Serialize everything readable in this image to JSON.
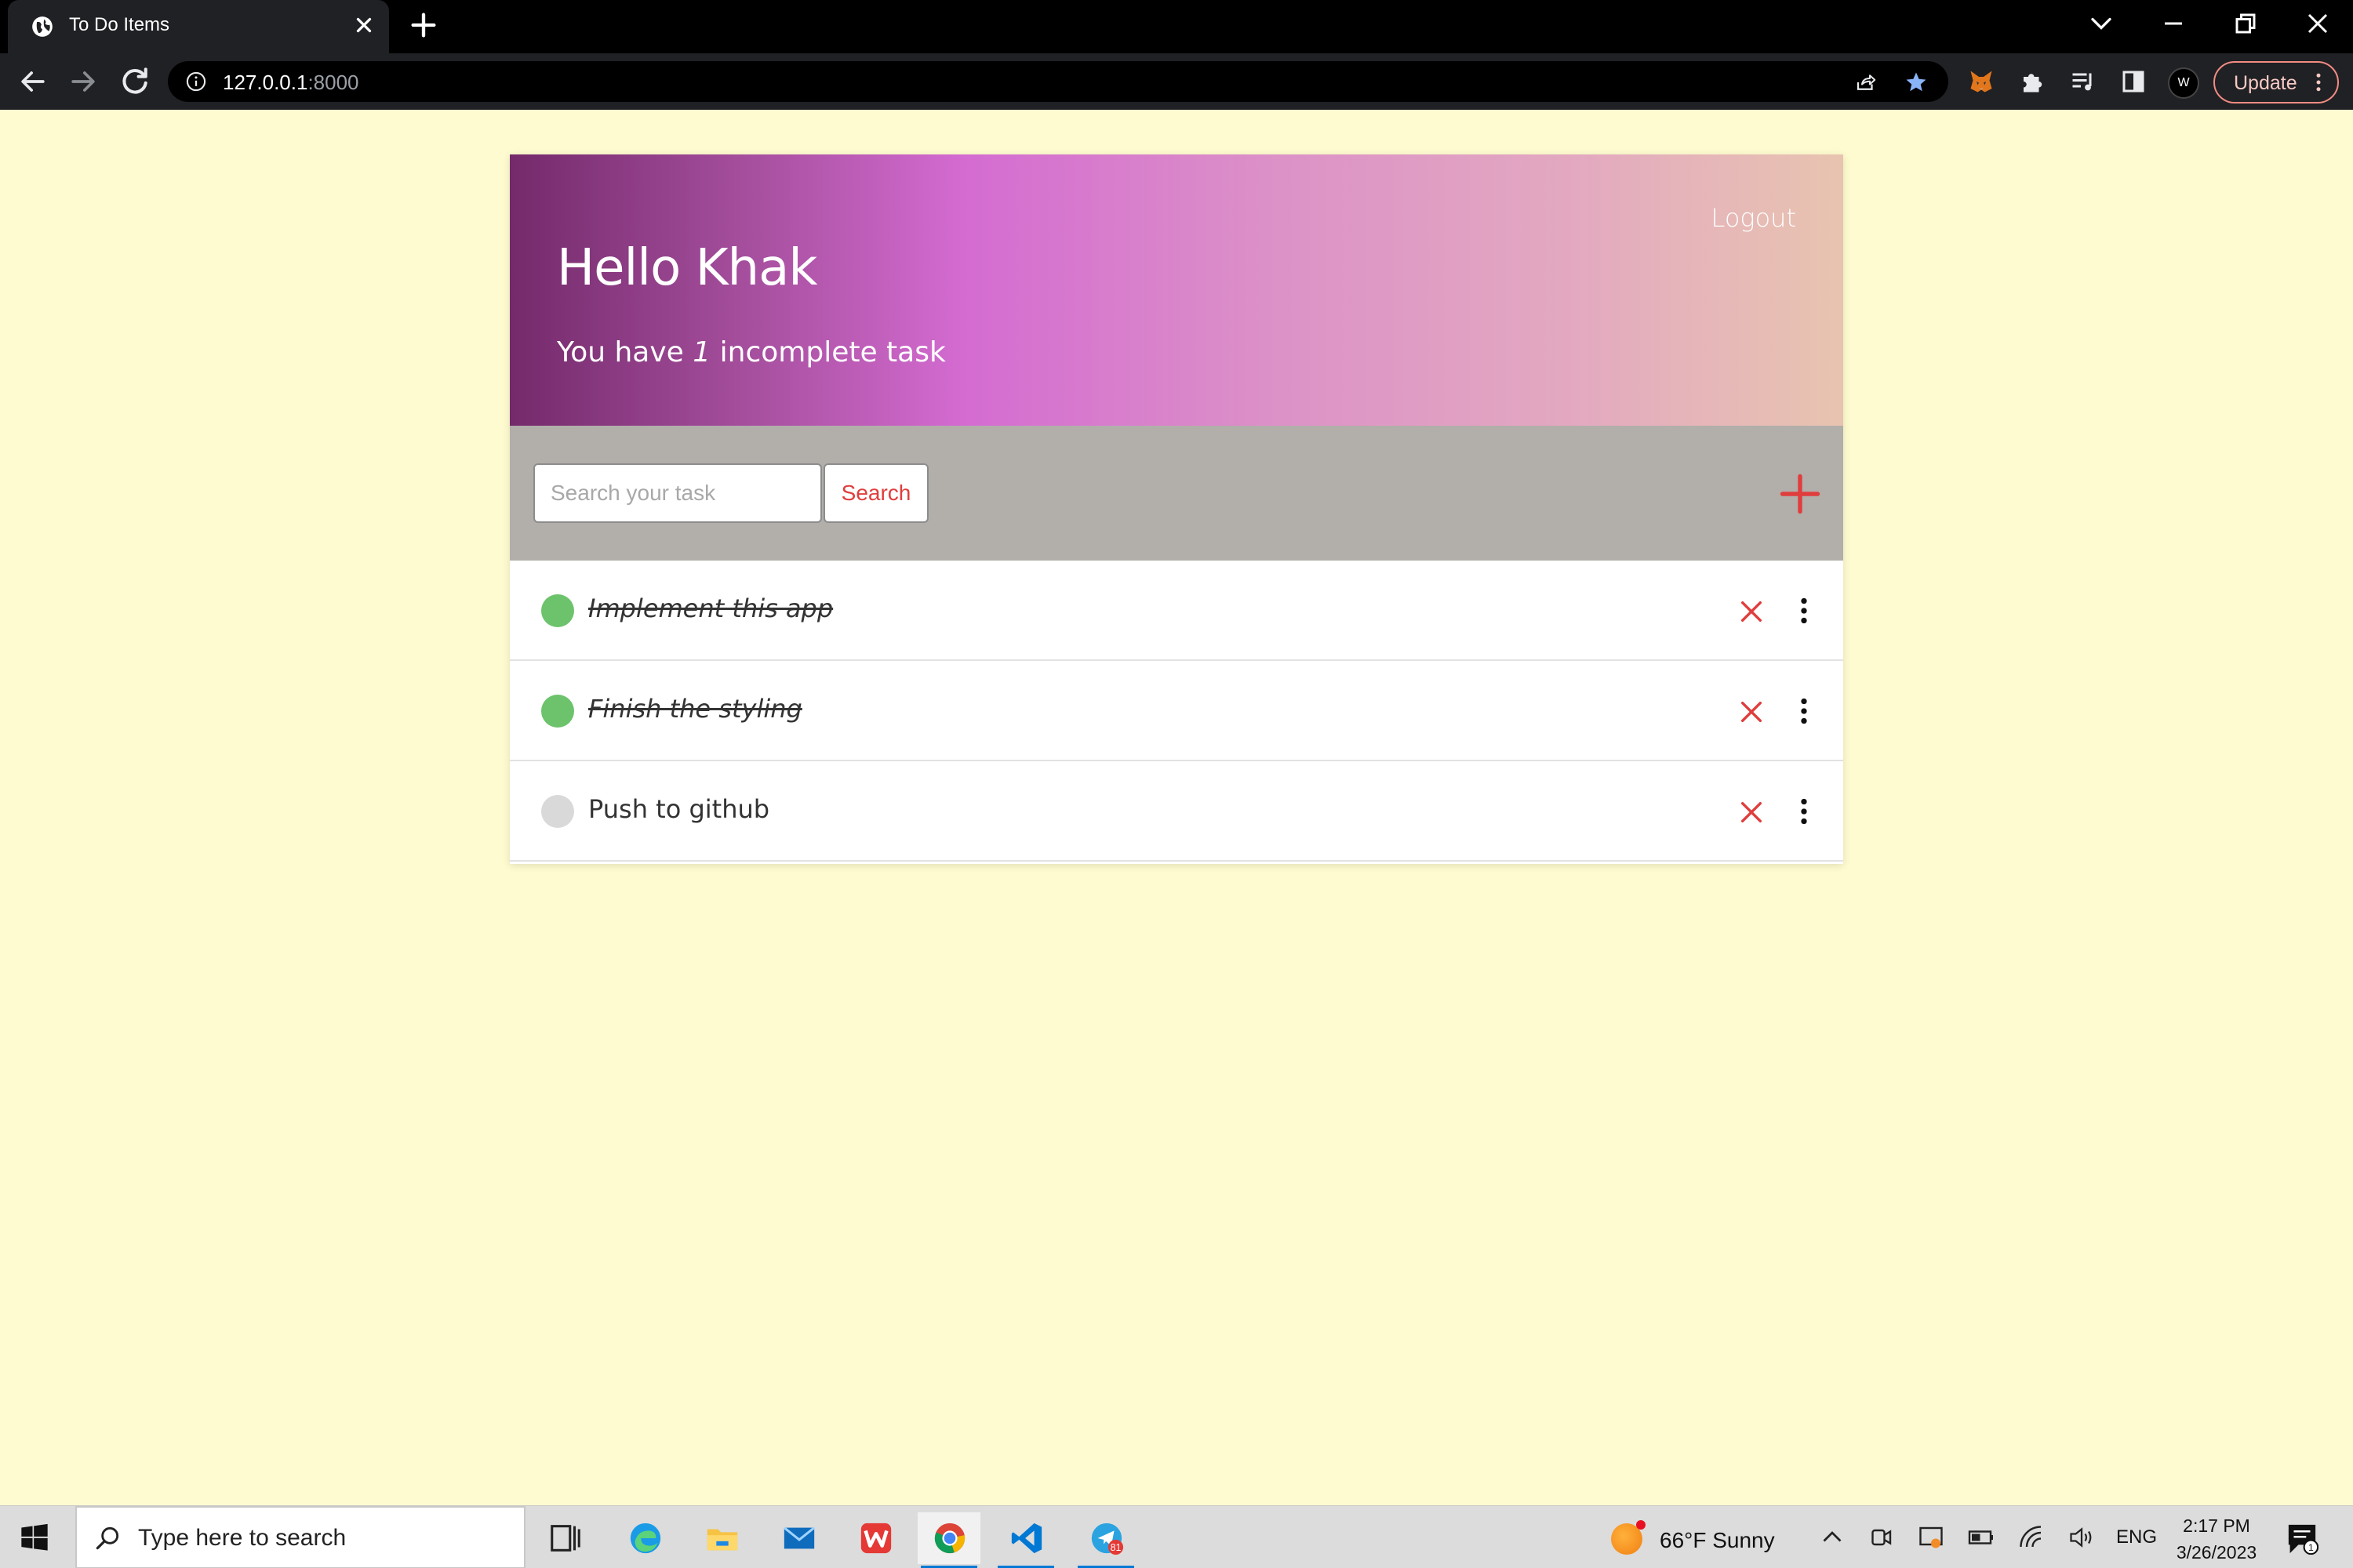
{
  "browser": {
    "tab_title": "To Do Items",
    "url_host": "127.0.0.1",
    "url_port": ":8000",
    "profile_initial": "W",
    "update_label": "Update"
  },
  "page": {
    "greeting": "Hello Khak",
    "subtitle_prefix": "You have ",
    "incomplete_count": "1",
    "subtitle_suffix": " incomplete task",
    "logout_label": "Logout",
    "search_placeholder": "Search your task",
    "search_button": "Search",
    "tasks": [
      {
        "title": "Implement this app",
        "completed": true
      },
      {
        "title": "Finish the styling",
        "completed": true
      },
      {
        "title": "Push to github",
        "completed": false
      }
    ],
    "colors": {
      "background": "#fffbd0",
      "accent_red": "#e03d3d",
      "completed_green": "#6cc36b",
      "incomplete_gray": "#d9d9d9",
      "searchbar_gray": "#b2aeaa"
    }
  },
  "taskbar": {
    "search_placeholder": "Type here to search",
    "weather": "66°F  Sunny",
    "language": "ENG",
    "time": "2:17 PM",
    "date": "3/26/2023",
    "telegram_badge": "81",
    "notification_count": "1"
  }
}
